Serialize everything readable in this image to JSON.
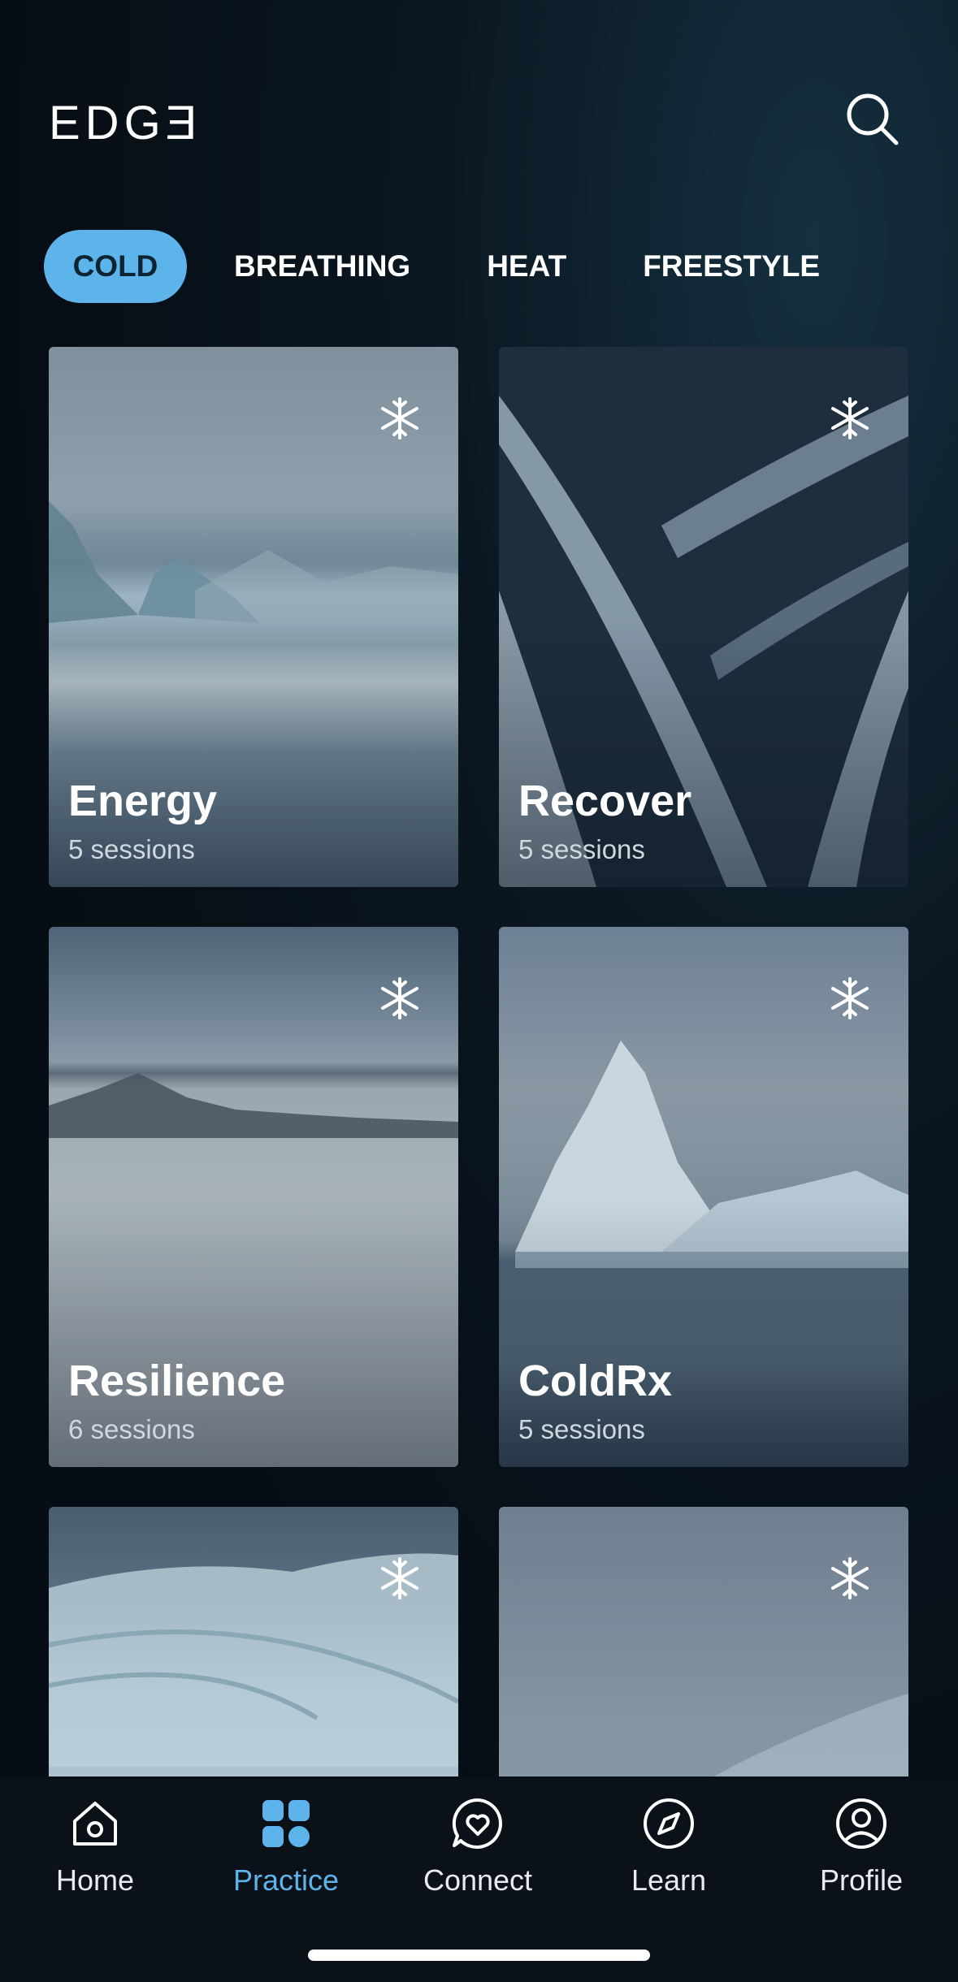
{
  "header": {
    "logo": "EDGƎ",
    "search_icon": "search-icon"
  },
  "tabs": [
    {
      "label": "COLD",
      "active": true
    },
    {
      "label": "BREATHING",
      "active": false
    },
    {
      "label": "HEAT",
      "active": false
    },
    {
      "label": "FREESTYLE",
      "active": false
    }
  ],
  "cards": [
    {
      "title": "Energy",
      "sessions": "5 sessions",
      "icon": "snowflake-icon"
    },
    {
      "title": "Recover",
      "sessions": "5 sessions",
      "icon": "snowflake-icon"
    },
    {
      "title": "Resilience",
      "sessions": "6 sessions",
      "icon": "snowflake-icon"
    },
    {
      "title": "ColdRx",
      "sessions": "5 sessions",
      "icon": "snowflake-icon"
    },
    {
      "title": "",
      "sessions": "",
      "icon": "snowflake-icon"
    },
    {
      "title": "",
      "sessions": "",
      "icon": "snowflake-icon"
    }
  ],
  "nav": [
    {
      "label": "Home",
      "icon": "home-icon",
      "active": false
    },
    {
      "label": "Practice",
      "icon": "practice-grid-icon",
      "active": true
    },
    {
      "label": "Connect",
      "icon": "heart-chat-icon",
      "active": false
    },
    {
      "label": "Learn",
      "icon": "compass-icon",
      "active": false
    },
    {
      "label": "Profile",
      "icon": "profile-icon",
      "active": false
    }
  ],
  "colors": {
    "accent": "#5db4ea",
    "background": "#070d14"
  }
}
